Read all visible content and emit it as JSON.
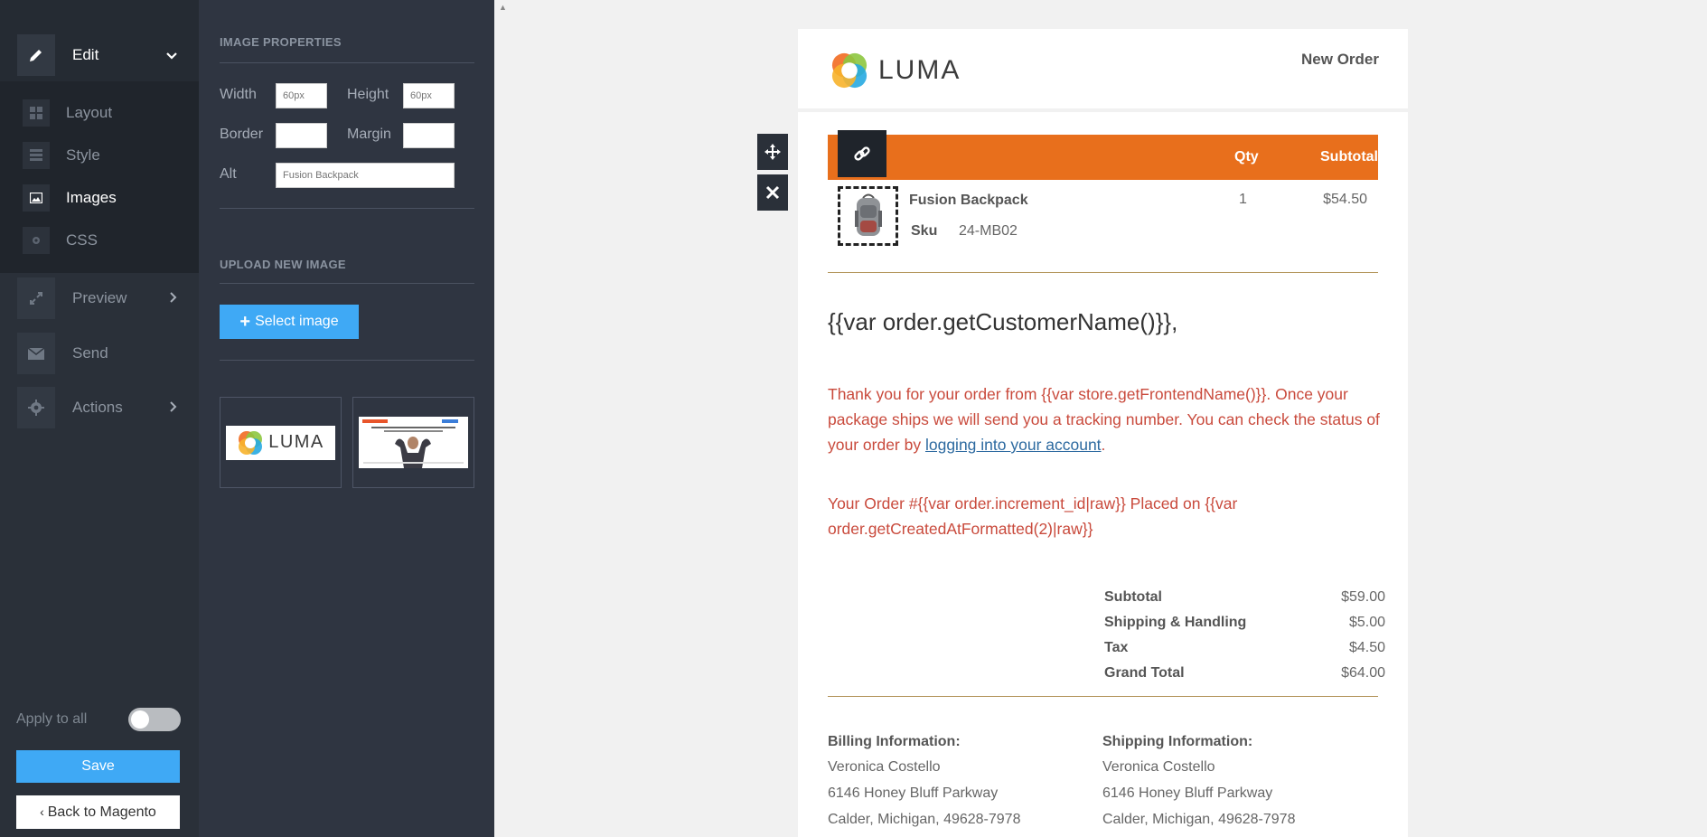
{
  "nav": {
    "edit_label": "Edit",
    "layout_label": "Layout",
    "style_label": "Style",
    "images_label": "Images",
    "css_label": "CSS",
    "preview_label": "Preview",
    "send_label": "Send",
    "actions_label": "Actions",
    "apply_to_all_label": "Apply to all",
    "apply_to_all_on": false,
    "save_label": "Save",
    "back_label": "Back to Magento"
  },
  "panel": {
    "image_properties_heading": "IMAGE PROPERTIES",
    "width_label": "Width",
    "width_placeholder": "60px",
    "height_label": "Height",
    "height_placeholder": "60px",
    "border_label": "Border",
    "border_value": "",
    "margin_label": "Margin",
    "margin_value": "",
    "alt_label": "Alt",
    "alt_placeholder": "Fusion Backpack",
    "upload_heading": "UPLOAD NEW IMAGE",
    "select_image_label": "Select image",
    "thumb1_text": "LUMA"
  },
  "email": {
    "logo_text": "LUMA",
    "order_type": "New Order",
    "col_qty": "Qty",
    "col_subtotal": "Subtotal",
    "item": {
      "name": "Fusion Backpack",
      "sku_label": "Sku",
      "sku": "24-MB02",
      "qty": "1",
      "subtotal": "$54.50"
    },
    "greeting": "{{var order.getCustomerName()}},",
    "message_before_link": "Thank you for your order from {{var store.getFrontendName()}}. Once your package ships we will send you a tracking number. You can check the status of your order by ",
    "message_link": "logging into your account",
    "message_after_link": ".",
    "order_line": "Your Order #{{var order.increment_id|raw}} Placed on {{var order.getCreatedAtFormatted(2)|raw}}",
    "totals": [
      {
        "label": "Subtotal",
        "value": "$59.00"
      },
      {
        "label": "Shipping & Handling",
        "value": "$5.00"
      },
      {
        "label": "Tax",
        "value": "$4.50"
      },
      {
        "label": "Grand Total",
        "value": "$64.00"
      }
    ],
    "billing": {
      "heading": "Billing Information:",
      "name": "Veronica Costello",
      "street": "6146 Honey Bluff Parkway",
      "city": "Calder, Michigan, 49628-7978"
    },
    "shipping": {
      "heading": "Shipping Information:",
      "name": "Veronica Costello",
      "street": "6146 Honey Bluff Parkway",
      "city": "Calder, Michigan, 49628-7978"
    }
  },
  "colors": {
    "nav_bg": "#2a3039",
    "panel_bg": "#2f3541",
    "accent_blue": "#3fa9f5",
    "table_header_orange": "#e86f1c",
    "message_red": "#c94a3c"
  }
}
